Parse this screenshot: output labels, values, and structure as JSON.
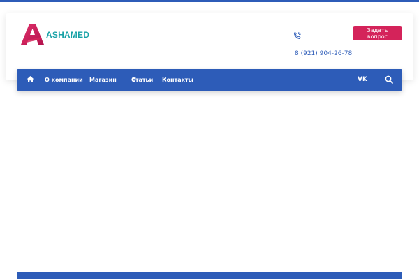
{
  "brand": {
    "name": "ASHAMED",
    "primary_color": "#2d5cb8",
    "accent_color": "#d4235a",
    "text_color": "#16a1a6"
  },
  "header": {
    "phone_icon": "phone-icon",
    "phone_number": "8 (921) 904-26-78",
    "ask_button_label": "Задать вопрос"
  },
  "nav": {
    "home_icon": "home-icon",
    "items": [
      {
        "label": "О компании"
      },
      {
        "label": "Магазин",
        "icon": "double-chevron-down-icon"
      },
      {
        "label": "Статьи"
      },
      {
        "label": "Контакты"
      }
    ],
    "social_icon": "vk-icon",
    "social_text": "VK",
    "search_icon": "search-icon"
  }
}
